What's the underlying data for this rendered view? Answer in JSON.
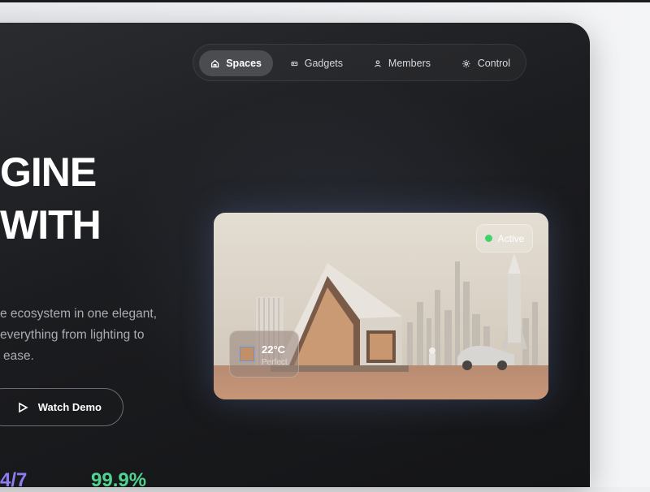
{
  "nav": {
    "items": [
      {
        "label": "Spaces",
        "icon": "home-icon",
        "active": true
      },
      {
        "label": "Gadgets",
        "icon": "gadget-icon",
        "active": false
      },
      {
        "label": "Members",
        "icon": "user-icon",
        "active": false
      },
      {
        "label": "Control",
        "icon": "gear-icon",
        "active": false
      }
    ]
  },
  "hero": {
    "headline_line1": "GINE",
    "headline_line2": "WITH",
    "desc_line1": "e ecosystem in one elegant,",
    "desc_line2": "everything from lighting to",
    "desc_line3": "ease.",
    "watch_demo_label": "Watch Demo"
  },
  "stats": {
    "left_value": "4/7",
    "right_value": "99.9%",
    "left_color": "#8f7cf2",
    "right_color": "#4fd38e"
  },
  "card": {
    "status_label": "Active",
    "status_color": "#3fd46a",
    "temperature": "22°C",
    "temperature_label": "Perfect"
  }
}
